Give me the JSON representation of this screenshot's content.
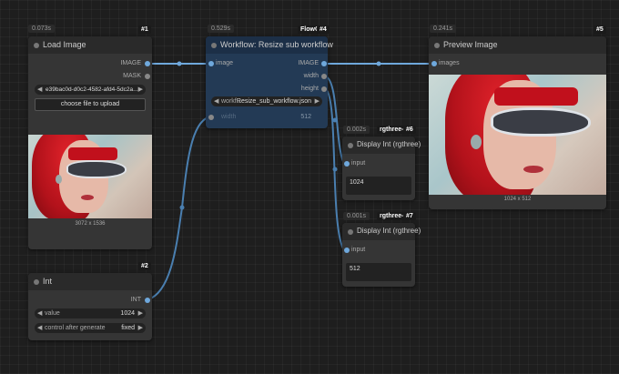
{
  "nodes": {
    "load_image": {
      "timing": "0.073s",
      "id": "#1",
      "title": "Load Image",
      "outputs": [
        "IMAGE",
        "MASK"
      ],
      "filename": "e39bac0d-d0c2-4582-afd4-5dc2a...",
      "upload_label": "choose file to upload",
      "image_size": "3072 x 1536"
    },
    "workflow": {
      "timing": "0.529s",
      "id": "#4",
      "badge_label": "FlowCl",
      "title": "Workflow: Resize sub workflow",
      "input": "image",
      "outputs": [
        "IMAGE",
        "width",
        "height"
      ],
      "workflow_label": "workf...",
      "workflow_value": "Resize_sub_workflow.json",
      "width_label": "width",
      "width_value": "512"
    },
    "preview_image": {
      "timing": "0.241s",
      "id": "#5",
      "title": "Preview Image",
      "input": "images",
      "image_size": "1024 x 512"
    },
    "display_int_6": {
      "timing": "0.002s",
      "badge": "rgthree-cc",
      "id": "#6",
      "title": "Display Int (rgthree)",
      "input": "input",
      "value": "1024"
    },
    "display_int_7": {
      "timing": "0.001s",
      "badge": "rgthree-cc",
      "id": "#7",
      "title": "Display Int (rgthree)",
      "input": "input",
      "value": "512"
    },
    "int_node": {
      "id": "#2",
      "title": "Int",
      "output": "INT",
      "value_label": "value",
      "value": "1024",
      "control_label": "control after generate",
      "control_value": "fixed"
    }
  },
  "colors": {
    "wire_image": "#6fa8dc",
    "wire_int": "#4a7fb0",
    "workflow_node_bg": "#233a55",
    "canvas_bg": "#1e1e1e"
  }
}
